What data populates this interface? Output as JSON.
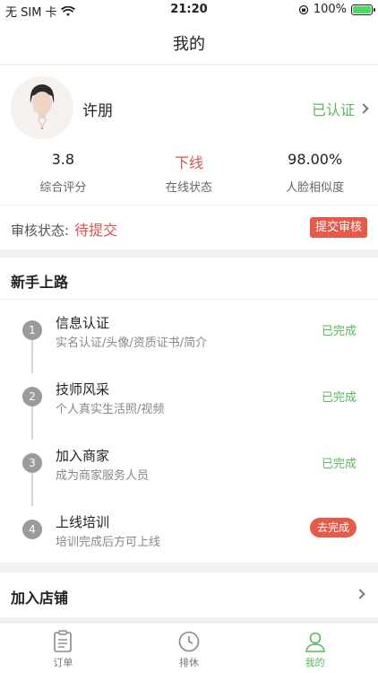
{
  "status_bar": {
    "carrier": "无 SIM 卡",
    "time": "21:20",
    "battery": "100%"
  },
  "nav": {
    "title": "我的"
  },
  "profile": {
    "name": "许朋",
    "verified_label": "已认证",
    "stats": [
      {
        "value": "3.8",
        "label": "综合评分"
      },
      {
        "value": "下线",
        "label": "在线状态"
      },
      {
        "value": "98.00%",
        "label": "人脸相似度"
      }
    ],
    "audit_label": "审核状态:",
    "audit_status": "待提交",
    "submit_button": "提交审核"
  },
  "newbie": {
    "title": "新手上路",
    "steps": [
      {
        "num": "1",
        "title": "信息认证",
        "desc": "实名认证/头像/资质证书/简介",
        "status": "已完成"
      },
      {
        "num": "2",
        "title": "技师风采",
        "desc": "个人真实生活照/视频",
        "status": "已完成"
      },
      {
        "num": "3",
        "title": "加入商家",
        "desc": "成为商家服务人员",
        "status": "已完成"
      },
      {
        "num": "4",
        "title": "上线培训",
        "desc": "培训完成后方可上线",
        "status": "去完成"
      }
    ]
  },
  "join_store": {
    "label": "加入店铺"
  },
  "tabbar": {
    "tabs": [
      {
        "label": "订单"
      },
      {
        "label": "排休"
      },
      {
        "label": "我的"
      }
    ]
  },
  "colors": {
    "accent_green": "#5cb85c",
    "accent_red": "#e45b4b"
  }
}
